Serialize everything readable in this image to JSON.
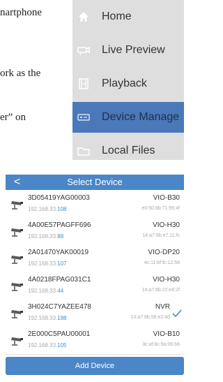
{
  "doc": {
    "lines": [
      "nartphone",
      "ork as the",
      "er” on"
    ]
  },
  "side_menu": {
    "items": [
      {
        "label": "Home",
        "icon": "home-icon"
      },
      {
        "label": "Live Preview",
        "icon": "camera-icon"
      },
      {
        "label": "Playback",
        "icon": "film-icon"
      },
      {
        "label": "Device Manage",
        "icon": "device-icon",
        "active": true
      },
      {
        "label": "Local Files",
        "icon": "folder-icon"
      }
    ]
  },
  "select_device": {
    "title": "Select Device",
    "back": "<",
    "add_button": "Add Device",
    "devices": [
      {
        "serial": "3D05419YAG00003",
        "ip_prefix": "192.168.33.",
        "ip_suffix": "108",
        "model": "VIO-B30",
        "mac": "e0:50:8b:71:95:4f"
      },
      {
        "serial": "4A00E57PAGFF696",
        "ip_prefix": "192.168.33.",
        "ip_suffix": "88",
        "model": "VIO-H30",
        "mac": "14:a7:8b:e7:11:fc"
      },
      {
        "serial": "2A01470YAK00019",
        "ip_prefix": "192.168.33.",
        "ip_suffix": "107",
        "model": "VIO-DP20",
        "mac": "4c:11:bf:fc:12:58"
      },
      {
        "serial": "4A0218FPAG031C1",
        "ip_prefix": "192.168.33.",
        "ip_suffix": "44",
        "model": "VIO-H30",
        "mac": "14:a7:8b:22:e8:2f"
      },
      {
        "serial": "3H024C7YAZEE478",
        "ip_prefix": "192.168.33.",
        "ip_suffix": "188",
        "model": "NVR",
        "mac": "14:a7:8b:56:e2:4d",
        "selected": true
      },
      {
        "serial": "2E000C5PAU00001",
        "ip_prefix": "192.168.33.",
        "ip_suffix": "105",
        "model": "VIO-B10",
        "mac": "3c:af:8c:9a:06:b6"
      }
    ]
  },
  "colors": {
    "accent": "#4a86c8",
    "menu_active": "#4b78b8",
    "menu_bg": "#dedede",
    "ip_highlight": "#3b8fd6"
  }
}
